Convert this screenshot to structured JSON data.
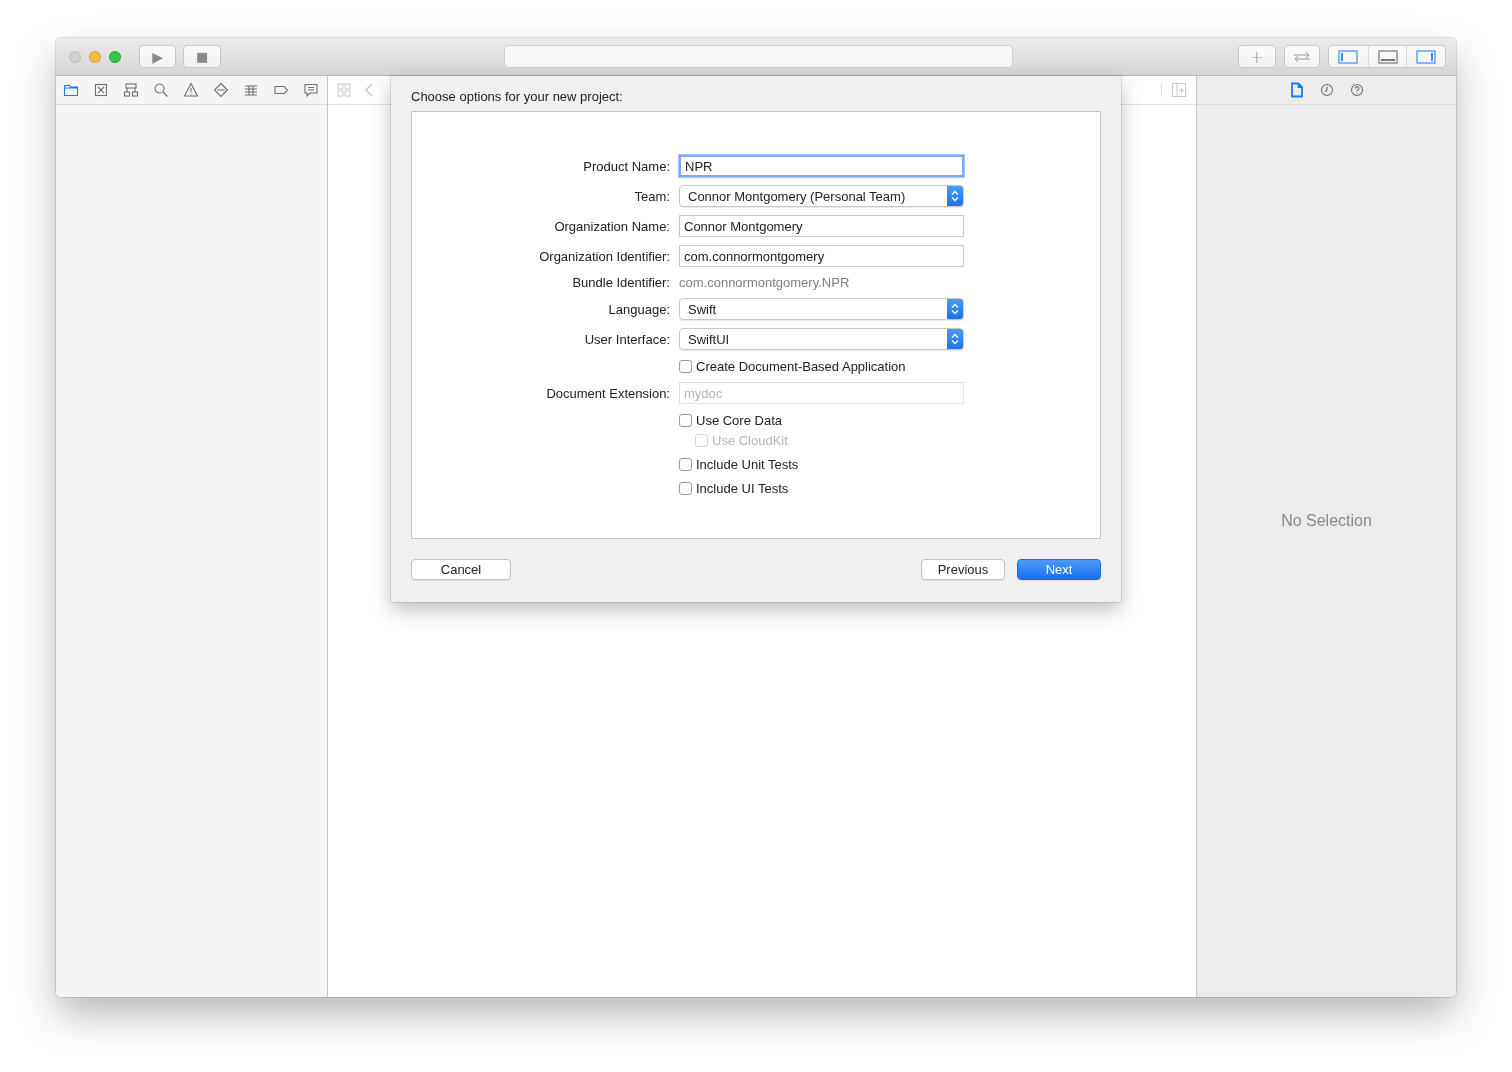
{
  "toolbar": {
    "run_button": {
      "symbol": "▶"
    },
    "stop_button": {
      "symbol": "■"
    },
    "add_button": {
      "symbol": "+"
    },
    "panel_toggles": [
      {
        "kind": "left",
        "on": true
      },
      {
        "kind": "bottom",
        "on": false
      },
      {
        "kind": "right",
        "on": true
      }
    ]
  },
  "navigator": {
    "tabs": [
      {
        "kind": "folder",
        "selected": true
      },
      {
        "kind": "source",
        "selected": false
      },
      {
        "kind": "hierarchy",
        "selected": false
      },
      {
        "kind": "search",
        "selected": false
      },
      {
        "kind": "warning",
        "selected": false
      },
      {
        "kind": "test",
        "selected": false
      },
      {
        "kind": "debug",
        "selected": false
      },
      {
        "kind": "breakpoint",
        "selected": false
      },
      {
        "kind": "report",
        "selected": false
      }
    ]
  },
  "inspector": {
    "tabs": [
      {
        "kind": "file",
        "selected": true
      },
      {
        "kind": "history",
        "selected": false
      },
      {
        "kind": "help",
        "selected": false
      }
    ],
    "empty_text": "No Selection"
  },
  "dialog": {
    "title": "Choose options for your new project:",
    "rows": [
      {
        "kind": "text",
        "label": "Product Name:",
        "value": "NPR",
        "focused": true,
        "disabled": false
      },
      {
        "kind": "popup",
        "label": "Team:",
        "value": "Connor Montgomery (Personal Team)"
      },
      {
        "kind": "text",
        "label": "Organization Name:",
        "value": "Connor Montgomery",
        "focused": false,
        "disabled": false
      },
      {
        "kind": "text",
        "label": "Organization Identifier:",
        "value": "com.connormontgomery",
        "focused": false,
        "disabled": false
      },
      {
        "kind": "static",
        "label": "Bundle Identifier:",
        "value": "com.connormontgomery.NPR"
      },
      {
        "kind": "popup",
        "label": "Language:",
        "value": "Swift"
      },
      {
        "kind": "popup",
        "label": "User Interface:",
        "value": "SwiftUI"
      },
      {
        "kind": "checkbox",
        "text": "Create Document-Based Application",
        "checked": false,
        "disabled": false
      },
      {
        "kind": "text",
        "label": "Document Extension:",
        "placeholder": "mydoc",
        "focused": false,
        "disabled": true
      },
      {
        "kind": "checkbox",
        "text": "Use Core Data",
        "checked": false,
        "disabled": false,
        "children": [
          {
            "text": "Use CloudKit",
            "checked": false,
            "disabled": true
          }
        ]
      },
      {
        "kind": "checkbox",
        "text": "Include Unit Tests",
        "checked": false,
        "disabled": false
      },
      {
        "kind": "checkbox",
        "text": "Include UI Tests",
        "checked": false,
        "disabled": false
      }
    ],
    "buttons": [
      {
        "label": "Cancel",
        "kind": "cancel"
      },
      {
        "label": "Previous",
        "kind": "normal"
      },
      {
        "label": "Next",
        "kind": "default"
      }
    ]
  }
}
